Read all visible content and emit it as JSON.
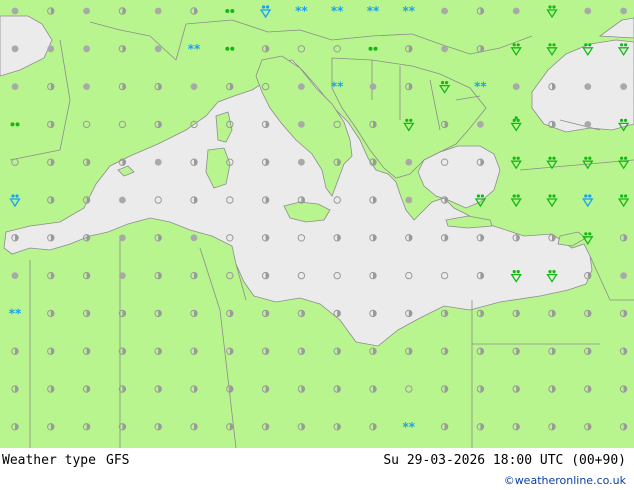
{
  "footer": {
    "title": "Weather type",
    "model": "GFS",
    "valid": "Su 29-03-2026 18:00 UTC (00+90)",
    "credit": "©weatheronline.co.uk"
  },
  "colors": {
    "land": "#b9f58e",
    "sea": "#ebebeb",
    "border": "#8c8c8c",
    "coast": "#8c8c8c",
    "dot_dry": "#a9a9a9",
    "cloud_outline": "#9a9a9a",
    "rain": "#14b814",
    "snow": "#1aa1f0"
  },
  "legend_icons": {
    "dot": "clear-dot-icon",
    "cloud": "cloudy-circle-icon",
    "half": "partly-cloudy-icon",
    "drizzle": "drizzle-icon",
    "rain": "rain-icon",
    "shower": "rain-shower-icon",
    "snow": "snow-icon",
    "snowshower": "snow-shower-icon",
    "thunder": "thunderstorm-icon"
  },
  "grid_rows": [
    "dhdhdh2xssssdhdrdd",
    "dddhdw2hcc2hdhrrrr",
    "dhdhhdhcdsdhrsdhdd",
    "2hcchcchdchrhdnhdr",
    "chhhdhchdhhdchrrrr",
    "vhhdchchhchdhrrrvr",
    "hhhdhdchchhhhhhhrh",
    "dhhdhhchcchcchrrhd",
    "shhhhhhhhhhhhhhhhh",
    "hhhhhhhhhhhhhhhhhh",
    "hhhhhhhhhhhchhhhhh",
    "hhhhhhhhhhhshhhhhh"
  ]
}
